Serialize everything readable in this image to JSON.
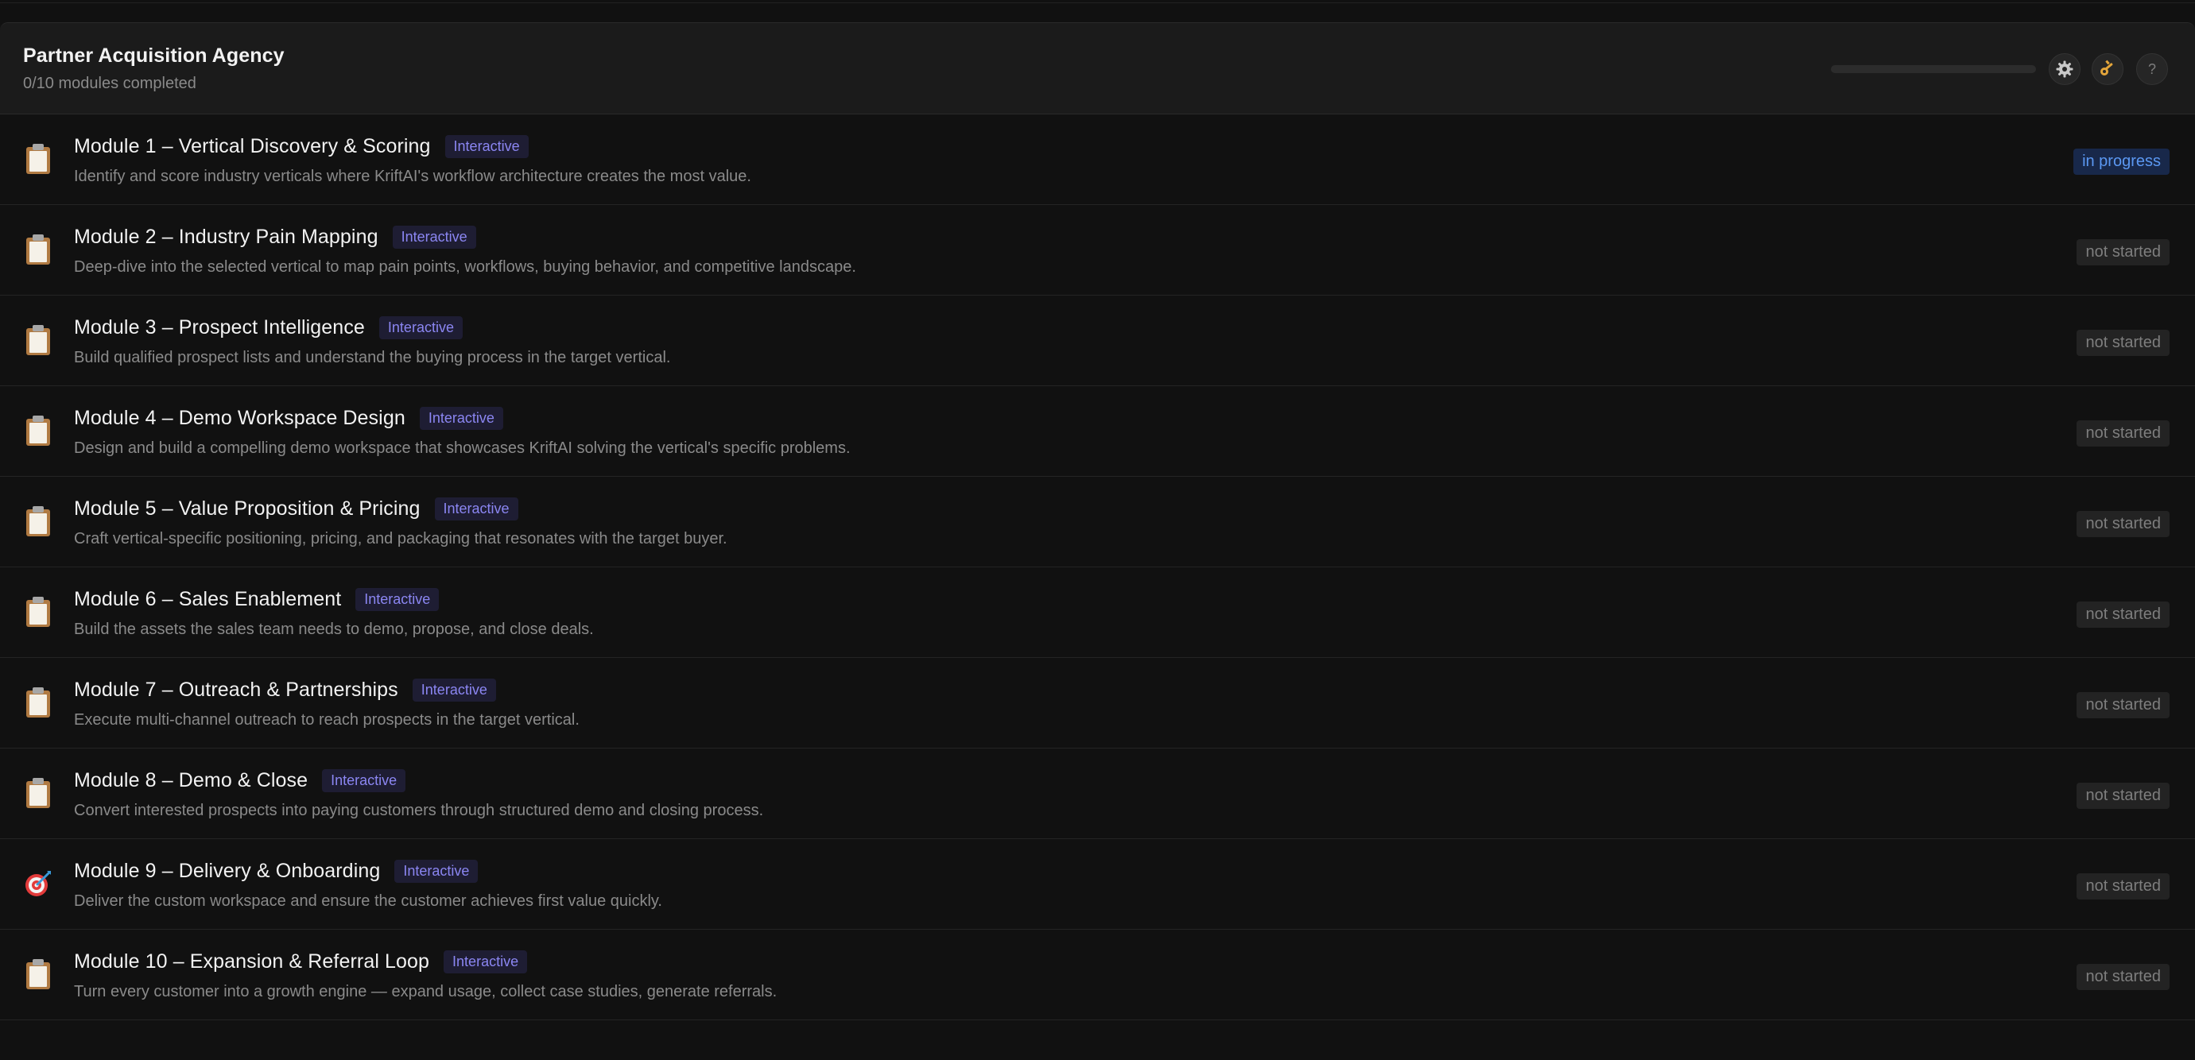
{
  "header": {
    "title": "Partner Acquisition Agency",
    "subtitle": "0/10 modules completed",
    "progress_percent": 0,
    "buttons": {
      "settings_icon": "gear-icon",
      "key_icon": "key-icon",
      "help_label": "?"
    }
  },
  "modules": [
    {
      "icon": "clipboard-icon",
      "title": "Module 1 – Vertical Discovery & Scoring",
      "tag": "Interactive",
      "description": "Identify and score industry verticals where KriftAI's workflow architecture creates the most value.",
      "status": "in progress"
    },
    {
      "icon": "clipboard-icon",
      "title": "Module 2 – Industry Pain Mapping",
      "tag": "Interactive",
      "description": "Deep-dive into the selected vertical to map pain points, workflows, buying behavior, and competitive landscape.",
      "status": "not started"
    },
    {
      "icon": "clipboard-icon",
      "title": "Module 3 – Prospect Intelligence",
      "tag": "Interactive",
      "description": "Build qualified prospect lists and understand the buying process in the target vertical.",
      "status": "not started"
    },
    {
      "icon": "clipboard-icon",
      "title": "Module 4 – Demo Workspace Design",
      "tag": "Interactive",
      "description": "Design and build a compelling demo workspace that showcases KriftAI solving the vertical's specific problems.",
      "status": "not started"
    },
    {
      "icon": "clipboard-icon",
      "title": "Module 5 – Value Proposition & Pricing",
      "tag": "Interactive",
      "description": "Craft vertical-specific positioning, pricing, and packaging that resonates with the target buyer.",
      "status": "not started"
    },
    {
      "icon": "clipboard-icon",
      "title": "Module 6 – Sales Enablement",
      "tag": "Interactive",
      "description": "Build the assets the sales team needs to demo, propose, and close deals.",
      "status": "not started"
    },
    {
      "icon": "clipboard-icon",
      "title": "Module 7 – Outreach & Partnerships",
      "tag": "Interactive",
      "description": "Execute multi-channel outreach to reach prospects in the target vertical.",
      "status": "not started"
    },
    {
      "icon": "clipboard-icon",
      "title": "Module 8 – Demo & Close",
      "tag": "Interactive",
      "description": "Convert interested prospects into paying customers through structured demo and closing process.",
      "status": "not started"
    },
    {
      "icon": "target-icon",
      "title": "Module 9 – Delivery & Onboarding",
      "tag": "Interactive",
      "description": "Deliver the custom workspace and ensure the customer achieves first value quickly.",
      "status": "not started"
    },
    {
      "icon": "clipboard-icon",
      "title": "Module 10 – Expansion & Referral Loop",
      "tag": "Interactive",
      "description": "Turn every customer into a growth engine — expand usage, collect case studies, generate referrals.",
      "status": "not started"
    }
  ],
  "colors": {
    "background": "#111111",
    "header_background": "#1b1b1b",
    "tag_text": "#8b86f2",
    "tag_background": "#1e1d33",
    "in_progress_text": "#5b98f2",
    "in_progress_background": "#18284a",
    "not_started_text": "#7e7e7e",
    "not_started_background": "#232323"
  }
}
